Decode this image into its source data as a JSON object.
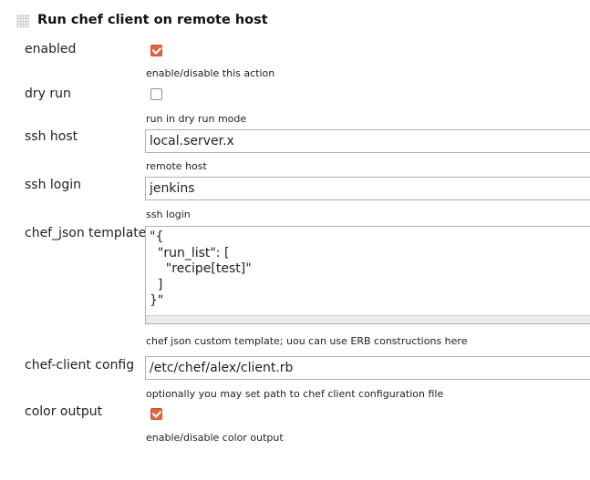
{
  "section": {
    "title": "Run chef client on remote host"
  },
  "fields": {
    "enabled": {
      "label": "enabled",
      "checked": true,
      "description": "enable/disable this action"
    },
    "dry_run": {
      "label": "dry run",
      "checked": false,
      "description": "run in dry run mode"
    },
    "ssh_host": {
      "label": "ssh host",
      "value": "local.server.x",
      "description": "remote host"
    },
    "ssh_login": {
      "label": "ssh login",
      "value": "jenkins",
      "description": "ssh login"
    },
    "chef_json": {
      "label": "chef_json template",
      "value": "\"{\n  \"run_list\": [\n    \"recipe[test]\"\n  ]\n}\"",
      "description": "chef json custom template; uou can use ERB constructions here"
    },
    "chef_client_config": {
      "label": "chef-client config",
      "value": "/etc/chef/alex/client.rb",
      "description": "optionally you may set path to chef client configuration file"
    },
    "color_output": {
      "label": "color output",
      "checked": true,
      "description": "enable/disable color output"
    }
  },
  "colors": {
    "checkbox_checked": "#e0673e",
    "input_border": "#b0b0b0"
  }
}
